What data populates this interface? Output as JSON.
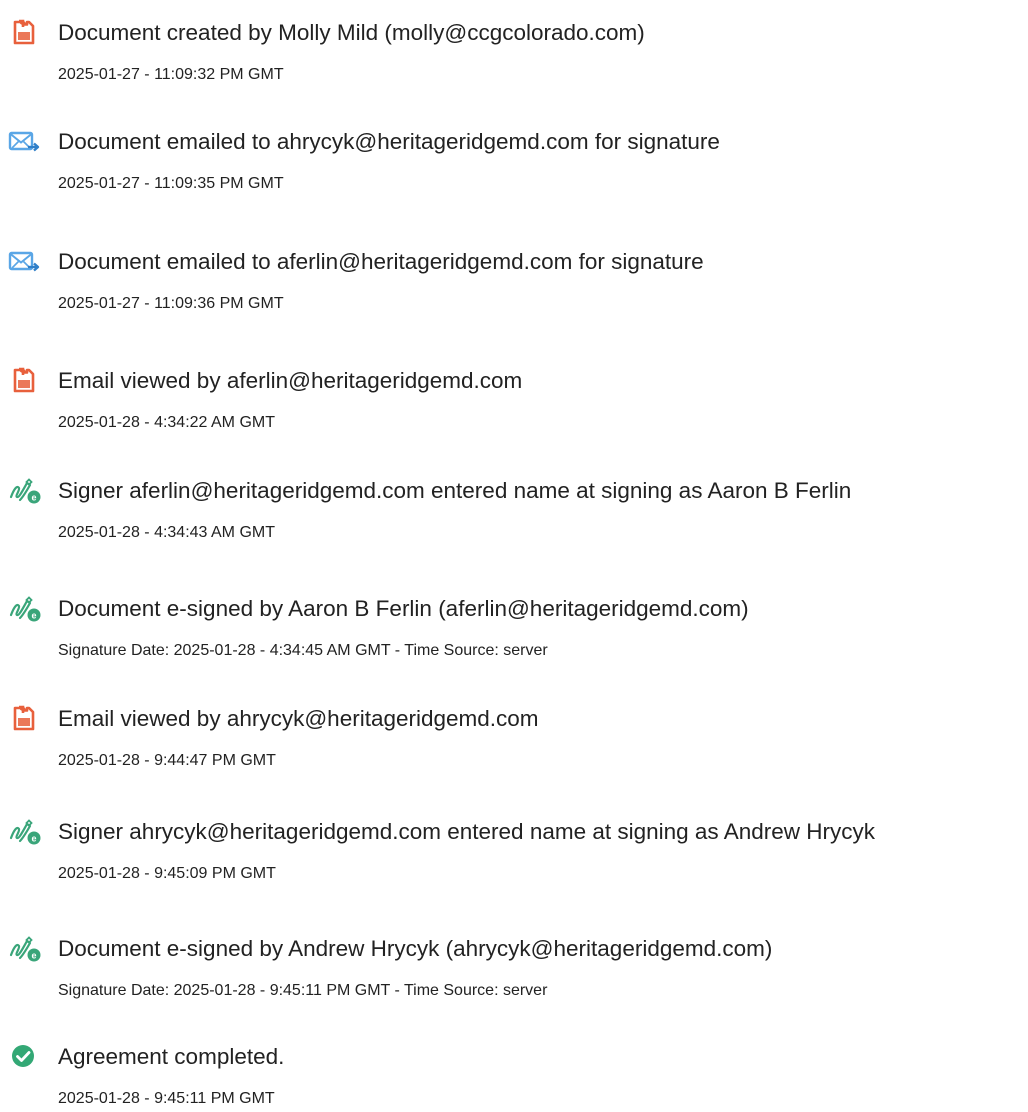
{
  "colors": {
    "doc_icon": "#e8603c",
    "email_icon": "#5aa6e6",
    "sign_icon": "#3aa57a",
    "complete_icon": "#33a875",
    "text": "#222222"
  },
  "events": [
    {
      "icon": "document-icon",
      "title": "Document created by Molly Mild (molly@ccgcolorado.com)",
      "time": "2025-01-27 - 11:09:32 PM GMT"
    },
    {
      "icon": "email-sent-icon",
      "title": "Document emailed to ahrycyk@heritageridgemd.com for signature",
      "time": "2025-01-27 - 11:09:35 PM GMT"
    },
    {
      "icon": "email-sent-icon",
      "title": "Document emailed to aferlin@heritageridgemd.com for signature",
      "time": "2025-01-27 - 11:09:36 PM GMT"
    },
    {
      "icon": "document-icon",
      "title": "Email viewed by aferlin@heritageridgemd.com",
      "time": "2025-01-28 - 4:34:22 AM GMT"
    },
    {
      "icon": "e-sign-pen-icon",
      "title": "Signer aferlin@heritageridgemd.com entered name at signing as Aaron B Ferlin",
      "time": "2025-01-28 - 4:34:43 AM GMT"
    },
    {
      "icon": "e-sign-pen-icon",
      "title": "Document e-signed by Aaron B Ferlin (aferlin@heritageridgemd.com)",
      "time": "Signature Date: 2025-01-28 - 4:34:45 AM GMT - Time Source: server"
    },
    {
      "icon": "document-icon",
      "title": "Email viewed by ahrycyk@heritageridgemd.com",
      "time": "2025-01-28 - 9:44:47 PM GMT"
    },
    {
      "icon": "e-sign-pen-icon",
      "title": "Signer ahrycyk@heritageridgemd.com entered name at signing as Andrew Hrycyk",
      "time": "2025-01-28 - 9:45:09 PM GMT"
    },
    {
      "icon": "e-sign-pen-icon",
      "title": "Document e-signed by Andrew Hrycyk (ahrycyk@heritageridgemd.com)",
      "time": "Signature Date: 2025-01-28 - 9:45:11 PM GMT - Time Source: server"
    },
    {
      "icon": "checkmark-circle-icon",
      "title": "Agreement completed.",
      "time": "2025-01-28 - 9:45:11 PM GMT"
    }
  ]
}
